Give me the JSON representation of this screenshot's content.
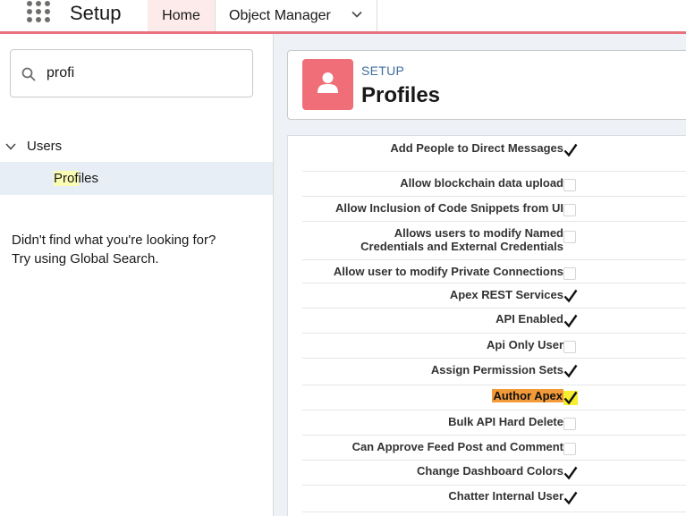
{
  "header": {
    "app_title": "Setup",
    "tabs": [
      {
        "label": "Home"
      },
      {
        "label": "Object Manager"
      }
    ]
  },
  "sidebar": {
    "search_value": "profi",
    "tree": {
      "parent_label": "Users",
      "child_label_highlight": "Prof",
      "child_label_rest": "iles"
    },
    "not_found_line1": "Didn't find what you're looking for?",
    "not_found_line2": "Try using Global Search."
  },
  "page": {
    "breadcrumb": "SETUP",
    "title": "Profiles"
  },
  "permissions": [
    {
      "label": "Add People to Direct Messages",
      "checked": true
    },
    {
      "label": "Allow blockchain data upload",
      "checked": false
    },
    {
      "label": "Allow Inclusion of Code Snippets from UI",
      "checked": false
    },
    {
      "label": "Allows users to modify Named Credentials and External Credentials",
      "label_line1": "Allows users to modify Named",
      "label_line2": "Credentials and External Credentials",
      "checked": false
    },
    {
      "label": "Allow user to modify Private Connections",
      "checked": false
    },
    {
      "label": "Apex REST Services",
      "checked": true
    },
    {
      "label": "API Enabled",
      "checked": true
    },
    {
      "label": "Api Only User",
      "checked": false
    },
    {
      "label": "Assign Permission Sets",
      "checked": true
    },
    {
      "label": "Author Apex",
      "checked": true,
      "highlighted": true
    },
    {
      "label": "Bulk API Hard Delete",
      "checked": false
    },
    {
      "label": "Can Approve Feed Post and Comment",
      "checked": false
    },
    {
      "label": "Change Dashboard Colors",
      "checked": true
    },
    {
      "label": "Chatter Internal User",
      "checked": true
    }
  ],
  "colors": {
    "brand_bar": "#e8727e",
    "profile_icon_bg": "#ef6e78",
    "label_highlight": "#f29a3a",
    "checkbox_highlight": "#f6ee2e",
    "search_highlight": "#fbfcb4"
  }
}
